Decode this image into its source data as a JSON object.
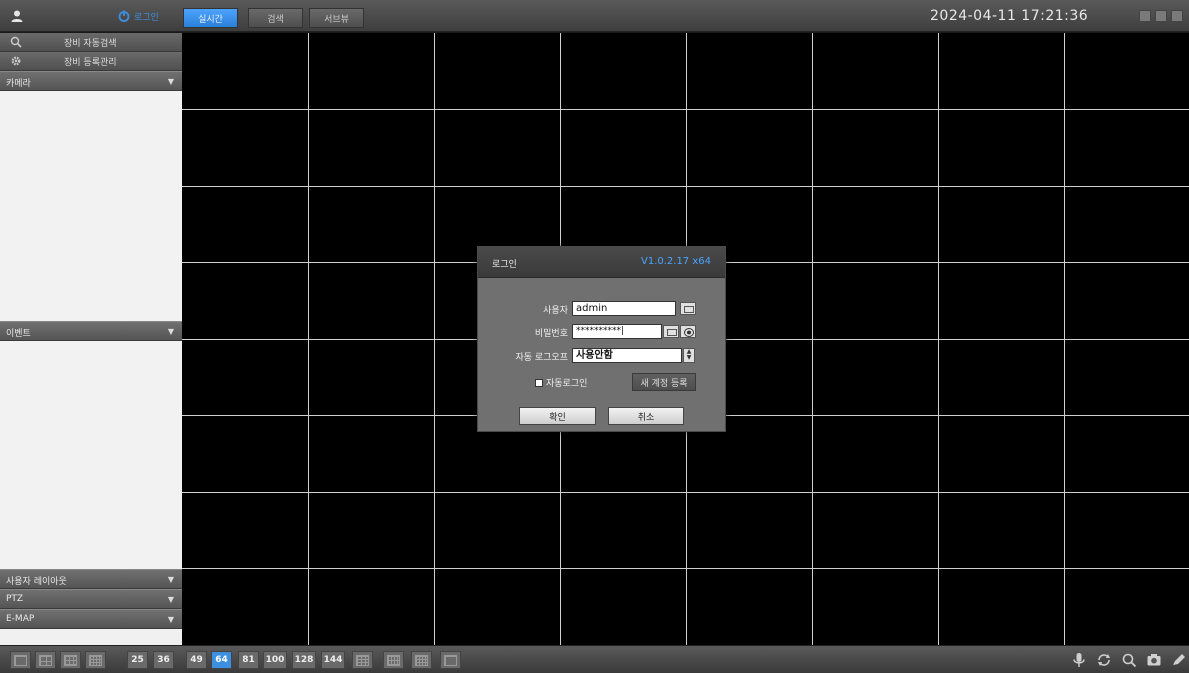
{
  "header": {
    "login_label": "로그인",
    "tabs": [
      {
        "label": "실시간",
        "active": true
      },
      {
        "label": "검색",
        "active": false
      },
      {
        "label": "서브뷰",
        "active": false
      }
    ],
    "datetime": "2024-04-11 17:21:36"
  },
  "sidebar": {
    "tools": [
      {
        "label": "장비 자동검색",
        "icon": "search-icon"
      },
      {
        "label": "장비 등록관리",
        "icon": "gear-icon"
      }
    ],
    "sections": {
      "camera": "카메라",
      "event": "이벤트",
      "user_layout": "사용자 레이아웃",
      "ptz": "PTZ",
      "emap": "E-MAP"
    }
  },
  "layout_buttons": {
    "numbers": [
      "25",
      "36",
      "49",
      "64",
      "81",
      "100",
      "128",
      "144"
    ],
    "active": "64"
  },
  "login_dialog": {
    "title": "로그인",
    "version": "V1.0.2.17 x64",
    "user_label": "사용자",
    "user_value": "admin",
    "password_label": "비밀번호",
    "password_value": "**********|",
    "autologoff_label": "자동 로그오프",
    "autologoff_value": "사용안함",
    "autologin_label": "자동로그인",
    "new_account_label": "새 계정 등록",
    "ok_label": "확인",
    "cancel_label": "취소"
  },
  "colors": {
    "accent": "#3d8fe0",
    "version_text": "#4aa3ff"
  }
}
